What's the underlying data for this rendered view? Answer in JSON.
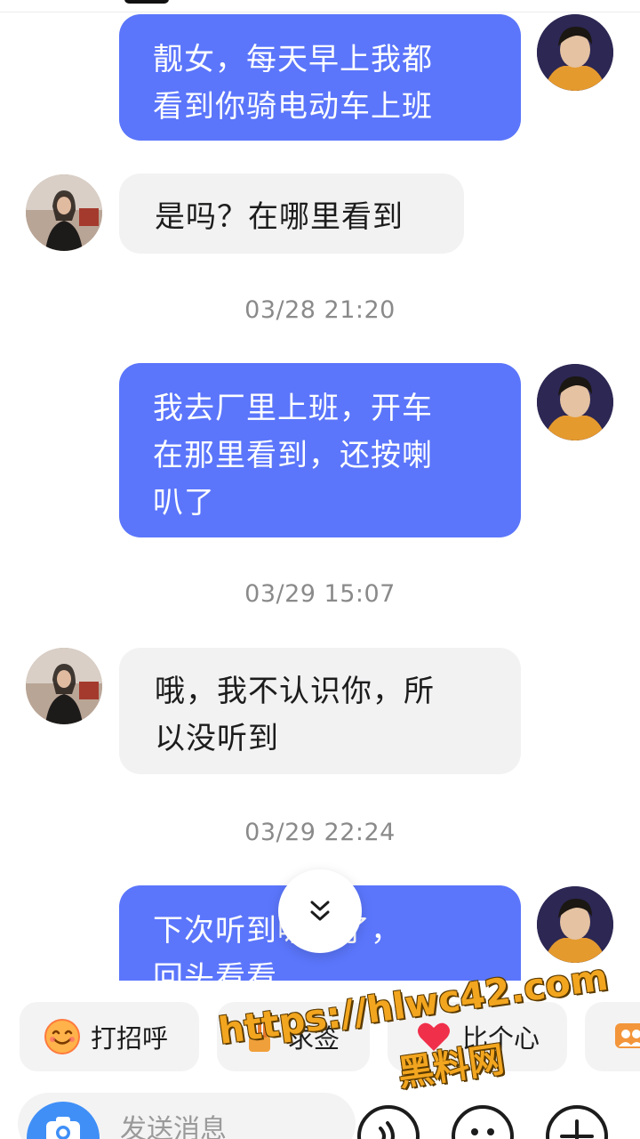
{
  "colors": {
    "outgoing_bubble": "#5b76fb",
    "incoming_bubble": "#f2f2f3",
    "timestamp_text": "#8a8a8a",
    "watermark": "#f2a51f",
    "camera_button": "#3f8ff7"
  },
  "messages": [
    {
      "direction": "outgoing",
      "lines": [
        "靓女，每天早上我都",
        "看到你骑电动车上班"
      ]
    },
    {
      "direction": "incoming",
      "lines": [
        "是吗？在哪里看到"
      ]
    },
    {
      "direction": "timestamp",
      "text": "03/28 21:20"
    },
    {
      "direction": "outgoing",
      "lines": [
        "我去厂里上班，开车",
        "在那里看到，还按喇",
        "叭了"
      ]
    },
    {
      "direction": "timestamp",
      "text": "03/29 15:07"
    },
    {
      "direction": "incoming",
      "lines": [
        "哦，我不认识你，所",
        "以没听到"
      ]
    },
    {
      "direction": "timestamp",
      "text": "03/29 22:24"
    },
    {
      "direction": "outgoing",
      "lines": [
        "下次听到喇叭了，",
        "回头看看"
      ]
    }
  ],
  "quick_actions": [
    {
      "label": "打招呼",
      "icon": "smile-emoji-icon"
    },
    {
      "label": "求签",
      "icon": "fortune-stick-icon"
    },
    {
      "label": "比个心",
      "icon": "heart-icon"
    },
    {
      "label": "",
      "icon": "group-chat-icon"
    }
  ],
  "composer": {
    "placeholder": "发送消息",
    "icons": [
      "camera-icon",
      "voice-icon",
      "emoji-icon",
      "plus-icon"
    ]
  },
  "scroll_to_bottom": {
    "icon": "double-chevron-down-icon"
  },
  "watermark": {
    "url": "https://hlwc42.com",
    "name": "黑料网"
  }
}
